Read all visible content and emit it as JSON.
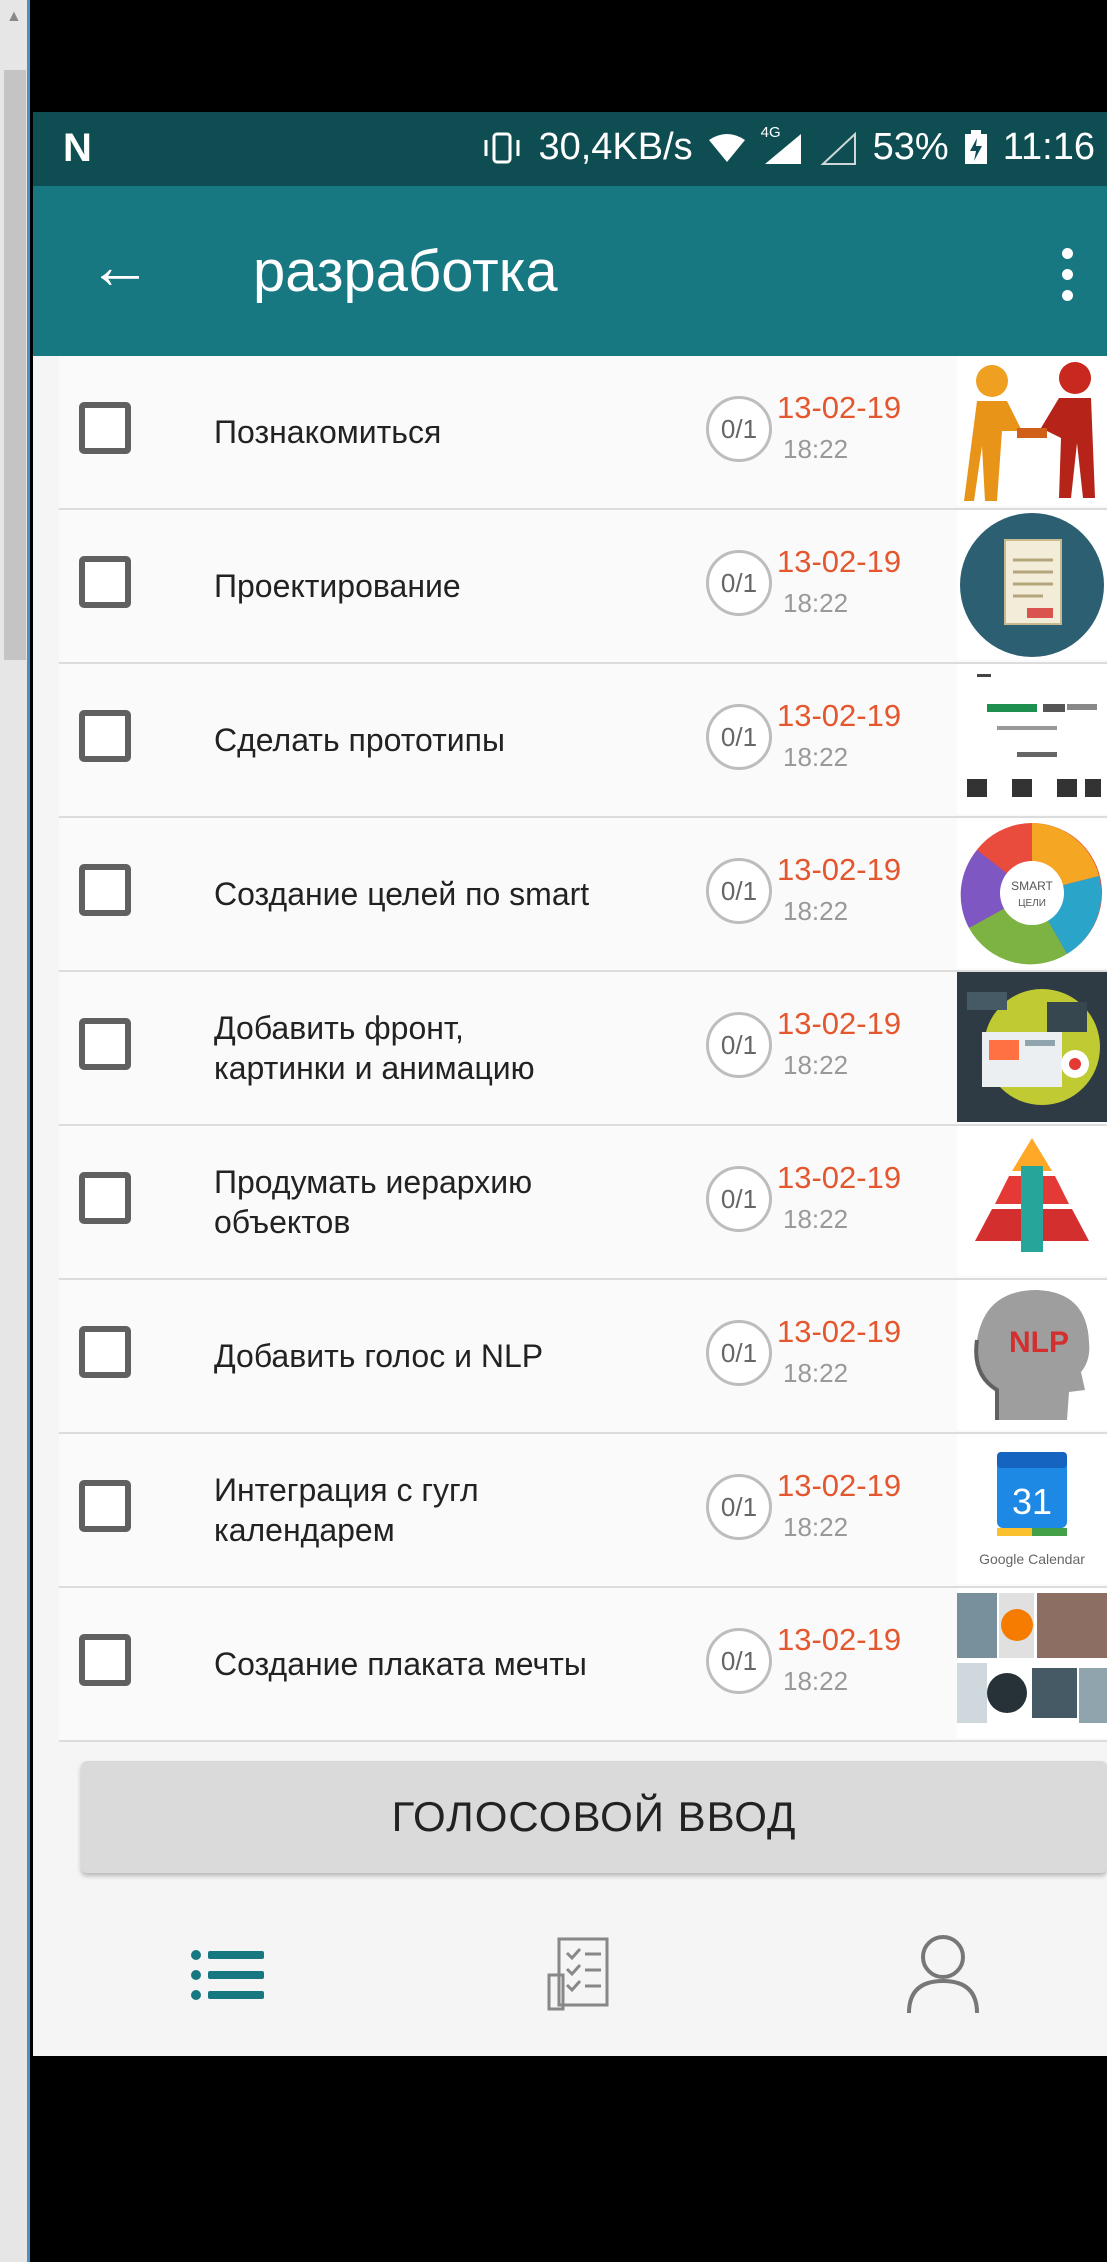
{
  "status_bar": {
    "logo": "N",
    "speed": "30,4KB/s",
    "network": "4G",
    "battery": "53%",
    "time": "11:16"
  },
  "toolbar": {
    "back_icon": "arrow-left-icon",
    "title": "разработка",
    "menu_icon": "more-vert-icon"
  },
  "tasks": [
    {
      "title": "Познакомиться",
      "progress": "0/1",
      "date": "13-02-19",
      "time": "18:22",
      "thumb": "handshake"
    },
    {
      "title": "Проектирование",
      "progress": "0/1",
      "date": "13-02-19",
      "time": "18:22",
      "thumb": "document"
    },
    {
      "title": "Сделать прототипы",
      "progress": "0/1",
      "date": "13-02-19",
      "time": "18:22",
      "thumb": "wireframes"
    },
    {
      "title": "Создание целей по smart",
      "progress": "0/1",
      "date": "13-02-19",
      "time": "18:22",
      "thumb": "smart-wheel"
    },
    {
      "title": "Добавить фронт, картинки и анимацию",
      "progress": "0/1",
      "date": "13-02-19",
      "time": "18:22",
      "thumb": "frontend"
    },
    {
      "title": "Продумать иерархию объектов",
      "progress": "0/1",
      "date": "13-02-19",
      "time": "18:22",
      "thumb": "pyramid"
    },
    {
      "title": "Добавить голос и NLP",
      "progress": "0/1",
      "date": "13-02-19",
      "time": "18:22",
      "thumb": "nlp-head"
    },
    {
      "title": "Интеграция с гугл календарем",
      "progress": "0/1",
      "date": "13-02-19",
      "time": "18:22",
      "thumb": "google-calendar"
    },
    {
      "title": "Создание плаката мечты",
      "progress": "0/1",
      "date": "13-02-19",
      "time": "18:22",
      "thumb": "dream-collage"
    }
  ],
  "thumb_text": {
    "smart_top": "SMART",
    "smart_bottom": "ЦЕЛИ",
    "nlp": "NLP",
    "calendar_day": "31",
    "calendar_label": "Google Calendar"
  },
  "voice_button": "ГОЛОСОВОЙ ВВОД",
  "bottom_nav": [
    {
      "icon": "list-icon",
      "active": true
    },
    {
      "icon": "checklist-icon",
      "active": false
    },
    {
      "icon": "person-icon",
      "active": false
    }
  ],
  "colors": {
    "status_bar": "#0e4e52",
    "toolbar": "#177882",
    "date": "#e4572e",
    "accent": "#177882"
  }
}
